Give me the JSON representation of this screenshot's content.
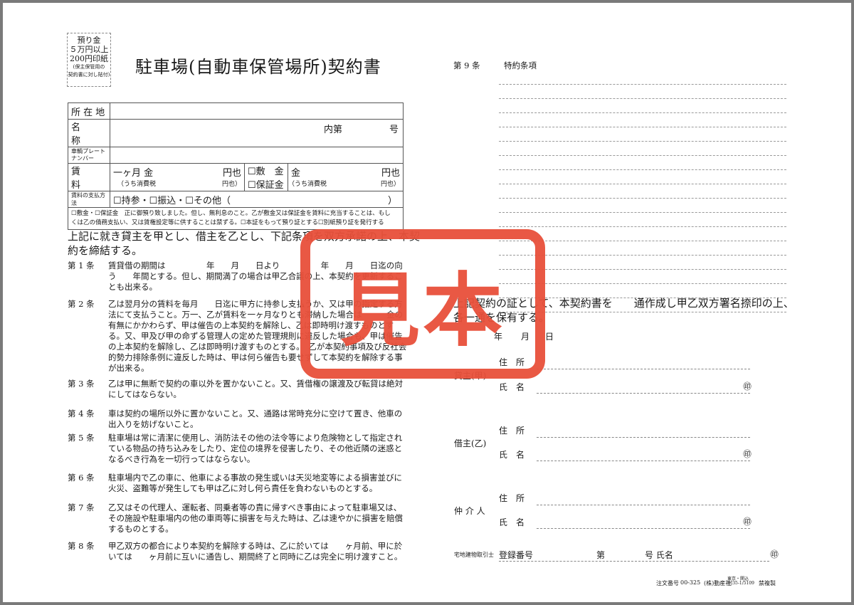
{
  "stamp_note": {
    "line1": "預り金",
    "line2": "５万円以上",
    "line3": "200円印紙",
    "line4": "(保主保管用の",
    "line5": "契約書に対し貼付)"
  },
  "title": "駐車場(自動車保管場所)契約書",
  "table": {
    "location_label": "所 在 地",
    "name_label": "名　　称",
    "name_unit": "内第",
    "name_number": "号",
    "plate_label_1": "車輌プレート",
    "plate_label_2": "ナンバー",
    "rent_label": "賃　　料",
    "rent_month": "一ヶ月 金",
    "rent_yen": "円也",
    "rent_tax": "（うち消費税",
    "rent_tax_yen": "円也）",
    "deposit_label": "☐敷　金",
    "guarantee_label": "☐保証金",
    "deposit_amount": "金",
    "deposit_yen": "円也",
    "deposit_tax": "（うち消費税",
    "deposit_tax_yen": "円也）",
    "payment_label": "賃料の支払方法",
    "payment_options": "☐持参・☐振込・☐その他（　　　　　　　　　　　　　　　　　）",
    "note_line1": "☐敷金・☐保証金　正に御預り致しました。但し、無利息のこと。乙が敷金又は保証金を賃料に充当することは、もし",
    "note_line2": "くは乙の債務支払い、又は賃権設定等に供することは禁ずる。☐本証をもって預り証とする☐別紙預り証を発行する"
  },
  "intro": {
    "line1": "上記に就き貸主を甲とし、借主を乙とし、下記条項を双方承諾の上、本契",
    "line2": "約を締結する。"
  },
  "articles": [
    {
      "no": "第 1 条",
      "text": "賃貸借の期間は　　　　　年　　月　　日より　　　　　年　　月　　日迄の向う　　年間とする。但し、期間満了の場合は甲乙合議の上、本契約を更新することも出来る。"
    },
    {
      "no": "第 2 条",
      "text": "乙は翌月分の賃料を毎月　　日迄に甲方に持参し支払うか、又は甲の指定する方法にて支払うこと。万一、乙が賃料を一ヶ月なりとも滞納した場合は　　　金の有無にかかわらず、甲は催告の上本契約を解除し、乙は即時明け渡すものとする。又、甲及び甲の命ずる管理人の定めた管理規則に違反した場合も、甲は催告の上本契約を解除し、乙は即時明け渡すものとする。　乙が本契約事項及び反社会的勢力排除条例に違反した時は、甲は何ら催告も要せずして本契約を解除する事が出来る。"
    },
    {
      "no": "第 3 条",
      "text": "乙は甲に無断で契約の車以外を置かないこと。又、賃借権の譲渡及び転貸は絶対にしてはならない。"
    },
    {
      "no": "第 4 条",
      "text": "車は契約の場所以外に置かないこと。又、通路は常時充分に空けて置き、他車の出入りを妨げないこと。"
    },
    {
      "no": "第 5 条",
      "text": "駐車場は常に清潔に使用し、消防法その他の法令等により危険物として指定されている物品の持ち込みをしたり、定位の境界を侵害したり、その他近隣の迷惑となるべき行為を一切行ってはならない。"
    },
    {
      "no": "第 6 条",
      "text": "駐車場内で乙の車に、他車による事故の発生或いは天災地変等による損害並びに火災、盗難等が発生しても甲は乙に対し何ら責任を負わないものとする。"
    },
    {
      "no": "第 7 条",
      "text": "乙又はその代理人、運転者、同乗者等の責に帰すべき事由によって駐車場又は、その施設や駐車場内の他の車両等に損害を与えた時は、乙は速やかに損害を賠償するものとする。"
    },
    {
      "no": "第 8 条",
      "text": "甲乙双方の都合により本契約を解除する時は、乙に於いては　　ヶ月前、甲に於いては　　ヶ月前に互いに通告し、期間終了と同時に乙は完全に明け渡すこと。"
    }
  ],
  "article9": {
    "no": "第 9 条",
    "title": "特約条項"
  },
  "closing": {
    "line1": "上記契約の証として、本契約書を　　通作成し甲乙双方署名捺印の上、",
    "line2": "各一通を保有する。"
  },
  "date": {
    "year": "年",
    "month": "月",
    "day": "日"
  },
  "parties": {
    "address": "住　所",
    "name": "氏　名",
    "seal": "㊞",
    "lessor": "貸主(甲)",
    "lessee": "借主(乙)",
    "agent": "仲 介 人"
  },
  "broker": {
    "label": "宅地建物取引士",
    "reg": "登録番号",
    "dai": "第",
    "go": "号 氏名",
    "seal": "㊞"
  },
  "watermark": "見本",
  "footer": {
    "left": "注文番号",
    "code": "00-325",
    "company": "(株)動産社",
    "branch": "東京・関込",
    "num": "DJ35-1/5109",
    "right": "禁複製"
  },
  "colors": {
    "watermark": "#e8503a",
    "paper": "#ffffff",
    "frame": "#7a7a7a"
  }
}
